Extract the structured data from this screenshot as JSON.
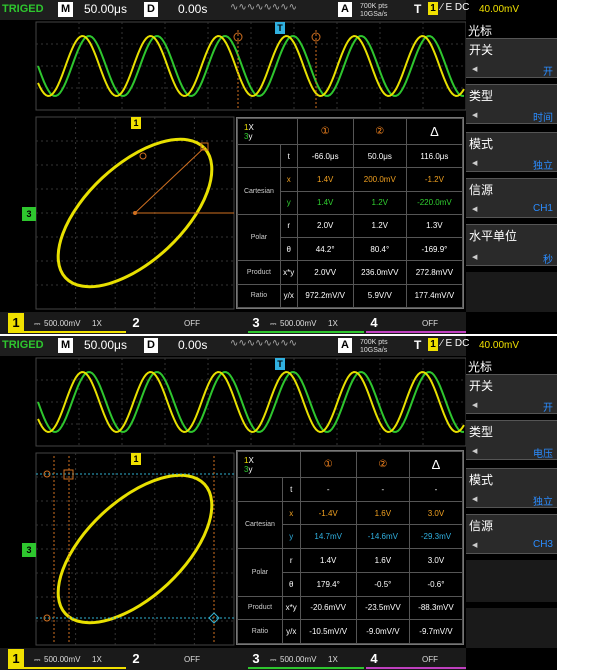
{
  "shared": {
    "trig": "TRIGED",
    "m": "M",
    "timebase": "50.00μs",
    "d": "D",
    "delay": "0.00s",
    "a": "A",
    "mem": "700K pts",
    "rate": "10GSa/s",
    "t": "T",
    "tch": "1",
    "tslope": "∕ E DC",
    "tlevel": "40.00mV",
    "ch1": "1",
    "ch1_scale": "500.00mV",
    "ch1_probe": "1X",
    "ch2": "2",
    "ch2_state": "OFF",
    "ch3": "3",
    "ch3_scale": "500.00mV",
    "ch3_probe": "1X",
    "ch4": "4",
    "ch4_state": "OFF",
    "marker_t": "T",
    "marker_1": "1",
    "y_marker": "3"
  },
  "screenA": {
    "menu": {
      "title": "光标",
      "items": [
        {
          "label": "开关",
          "value": "开"
        },
        {
          "label": "类型",
          "value": "时间"
        },
        {
          "label": "模式",
          "value": "独立"
        },
        {
          "label": "信源",
          "value": "CH1"
        },
        {
          "label": "水平单位",
          "value": "秒"
        }
      ]
    },
    "table": {
      "h1x": "1",
      "h1x_suffix": "X",
      "h3y": "3",
      "h3y_suffix": "y",
      "c1": "①",
      "c2": "②",
      "cd": "Δ",
      "t_label": "t",
      "t": [
        "-66.0μs",
        "50.0μs",
        "116.0μs"
      ],
      "cart_label": "Cartesian",
      "x_label": "x",
      "y_label": "y",
      "x": [
        "1.4V",
        "200.0mV",
        "-1.2V"
      ],
      "y": [
        "1.4V",
        "1.2V",
        "-220.0mV"
      ],
      "polar_label": "Polar",
      "r_label": "r",
      "theta_label": "θ",
      "r": [
        "2.0V",
        "1.2V",
        "1.3V"
      ],
      "theta": [
        "44.2°",
        "80.4°",
        "-169.9°"
      ],
      "product_label": "Product",
      "xy_label": "x*y",
      "xy": [
        "2.0VV",
        "236.0mVV",
        "272.8mVV"
      ],
      "ratio_label": "Ratio",
      "yx_label": "y/x",
      "yx": [
        "972.2mV/V",
        "5.9V/V",
        "177.4mV/V"
      ]
    }
  },
  "screenB": {
    "menu": {
      "title": "光标",
      "items": [
        {
          "label": "开关",
          "value": "开"
        },
        {
          "label": "类型",
          "value": "电压"
        },
        {
          "label": "模式",
          "value": "独立"
        },
        {
          "label": "信源",
          "value": "CH3"
        }
      ]
    },
    "table": {
      "h1x": "1",
      "h1x_suffix": "X",
      "h3y": "3",
      "h3y_suffix": "y",
      "c1": "①",
      "c2": "②",
      "cd": "Δ",
      "t_label": "t",
      "t": [
        "-",
        "-",
        "-"
      ],
      "cart_label": "Cartesian",
      "x_label": "x",
      "y_label": "y",
      "x": [
        "-1.4V",
        "1.6V",
        "3.0V"
      ],
      "y": [
        "14.7mV",
        "-14.6mV",
        "-29.3mV"
      ],
      "polar_label": "Polar",
      "r_label": "r",
      "theta_label": "θ",
      "r": [
        "1.4V",
        "1.6V",
        "3.0V"
      ],
      "theta": [
        "179.4°",
        "-0.5°",
        "-0.6°"
      ],
      "product_label": "Product",
      "xy_label": "x*y",
      "xy": [
        "-20.6mVV",
        "-23.5mVV",
        "-88.3mVV"
      ],
      "ratio_label": "Ratio",
      "yx_label": "y/x",
      "yx": [
        "-10.5mV/V",
        "-9.0mV/V",
        "-9.7mV/V"
      ]
    }
  }
}
